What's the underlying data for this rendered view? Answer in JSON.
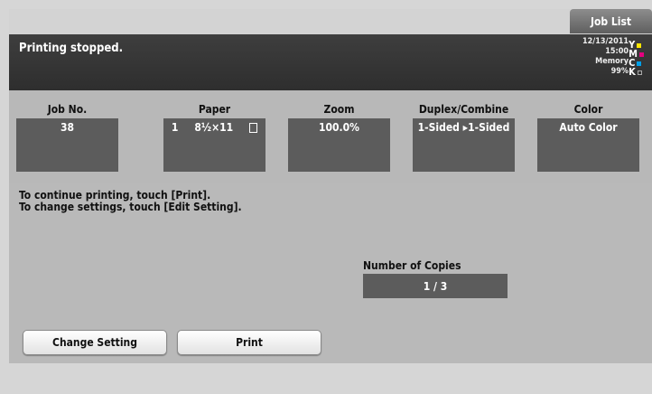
{
  "top": {
    "job_list_label": "Job List"
  },
  "status": {
    "message": "Printing stopped.",
    "date": "12/13/2011",
    "time": "15:00",
    "memory_label": "Memory",
    "memory_value": "99%",
    "toner": [
      {
        "letter": "Y",
        "color": "#ffe600"
      },
      {
        "letter": "M",
        "color": "#e4007f"
      },
      {
        "letter": "C",
        "color": "#00a0e9"
      },
      {
        "letter": "K",
        "color": "#333333"
      }
    ]
  },
  "job": {
    "job_no_label": "Job No.",
    "job_no": "38",
    "paper_label": "Paper",
    "paper_tray": "1",
    "paper_size": "8½×11",
    "zoom_label": "Zoom",
    "zoom": "100.0%",
    "duplex_label": "Duplex/Combine",
    "duplex": "1-Sided ▸1-Sided",
    "color_label": "Color",
    "color": "Auto Color"
  },
  "main": {
    "instruction_1": "To continue printing, touch [Print].",
    "instruction_2": "To change settings, touch [Edit Setting].",
    "copies_label": "Number of Copies",
    "copies_value": "1 / 3",
    "change_setting_label": "Change Setting",
    "print_label": "Print"
  }
}
